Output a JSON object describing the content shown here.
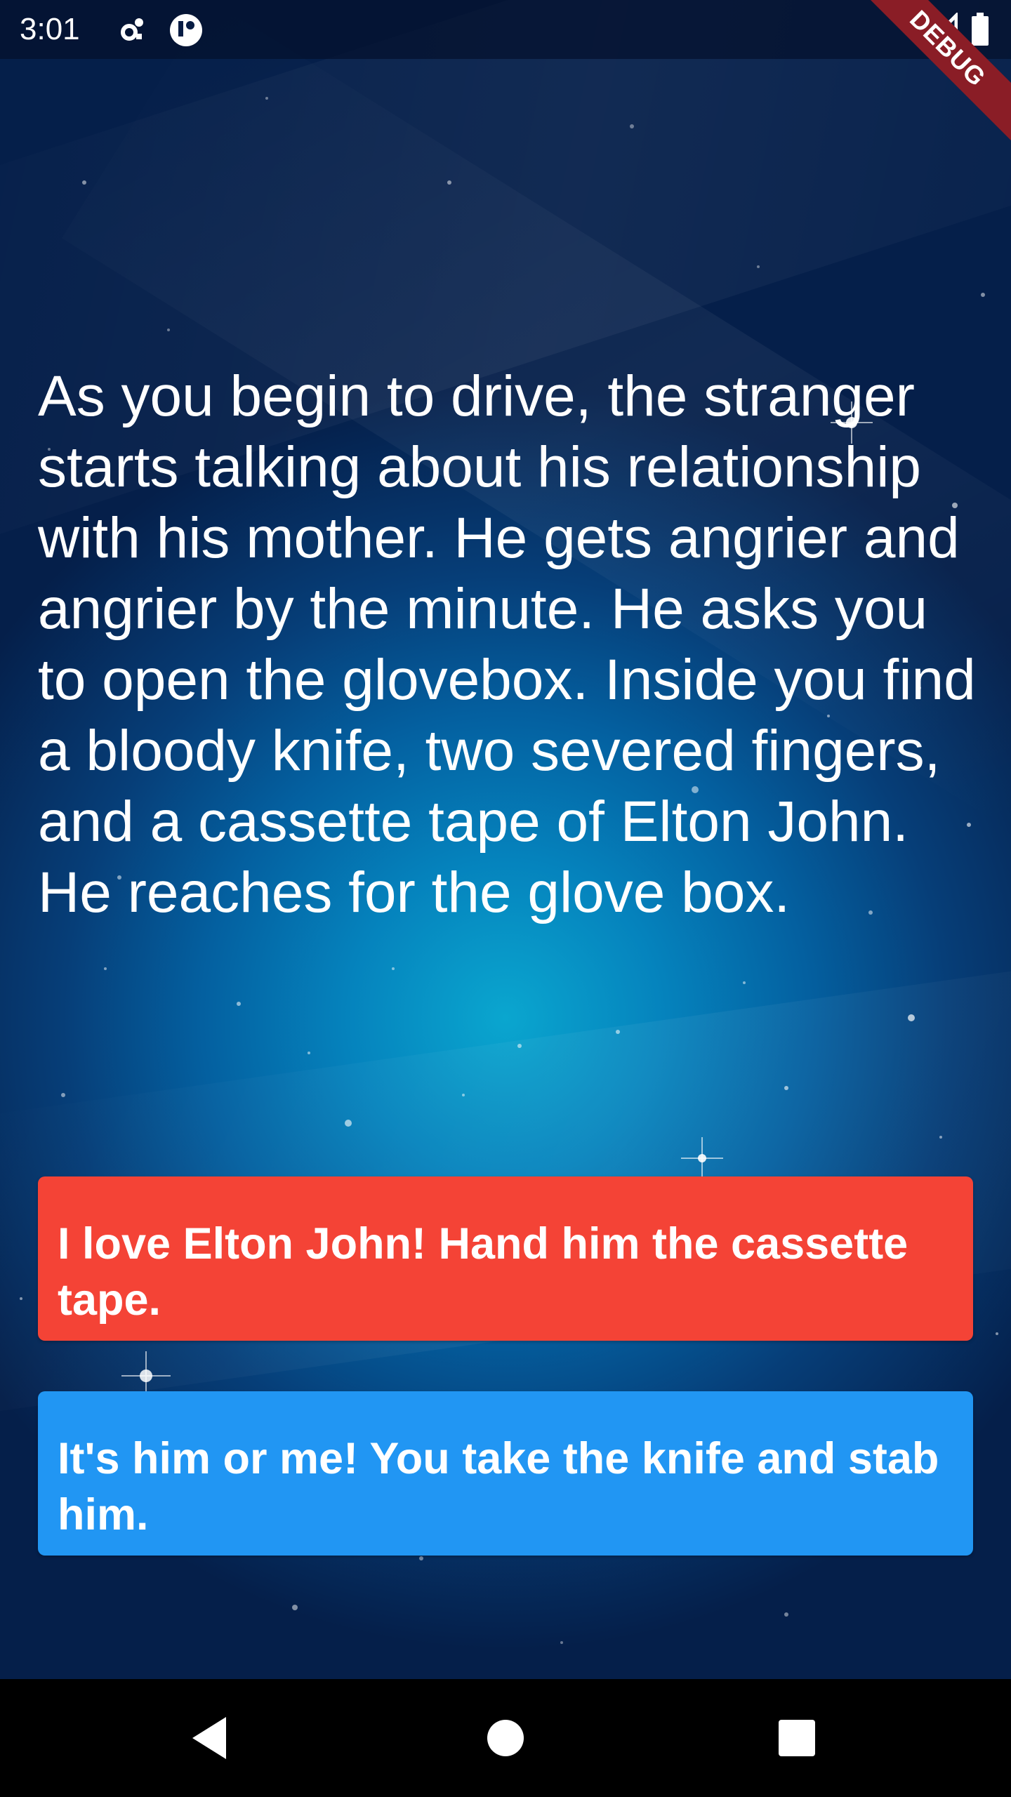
{
  "status_bar": {
    "time": "3:01",
    "icons": [
      "settings-sync-icon",
      "notification-icon",
      "signal-icon",
      "battery-icon"
    ]
  },
  "debug_banner": "DEBUG",
  "story": {
    "text": "As you begin to drive, the stranger starts talking about his relationship with his mother. He gets angrier and angrier by the minute. He asks you to open the glovebox. Inside you find a bloody knife, two severed fingers, and a cassette tape of Elton John. He reaches for the glove box."
  },
  "choices": [
    {
      "label": "I love Elton John! Hand him the cassette tape.",
      "color": "#f44336"
    },
    {
      "label": "It's him or me! You take the knife and stab him.",
      "color": "#2196f3"
    }
  ],
  "navigation": [
    "back-icon",
    "home-icon",
    "recents-icon"
  ],
  "colors": {
    "background_center": "#0aa6cf",
    "background_edge": "#051f4a",
    "ribbon": "#8a1d26"
  }
}
